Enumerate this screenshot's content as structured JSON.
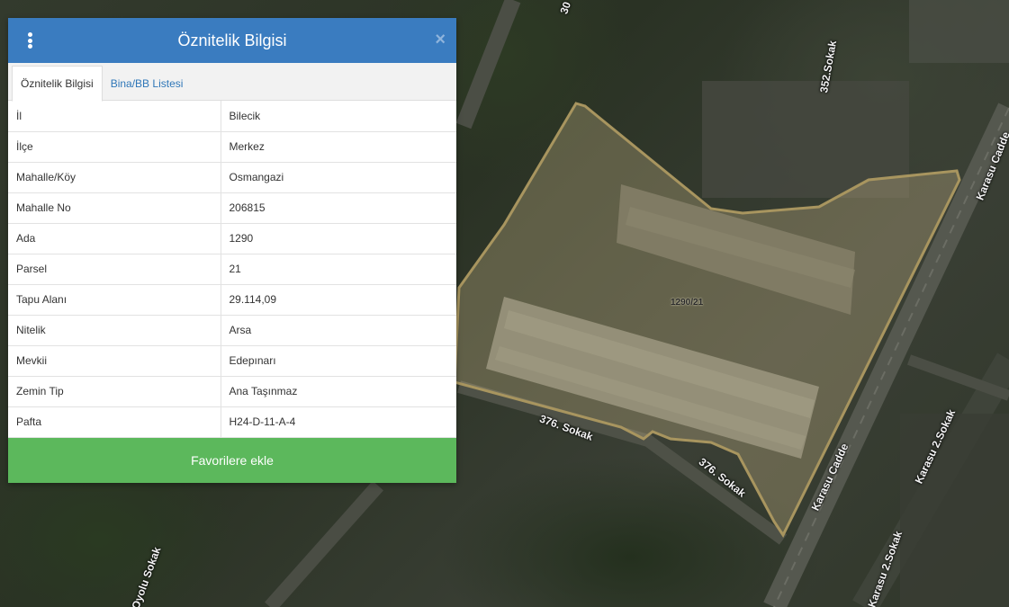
{
  "panel": {
    "title": "Öznitelik Bilgisi",
    "tabs": [
      {
        "label": "Öznitelik Bilgisi",
        "active": true
      },
      {
        "label": "Bina/BB Listesi",
        "active": false
      }
    ],
    "rows": [
      {
        "key": "İl",
        "value": "Bilecik"
      },
      {
        "key": "İlçe",
        "value": "Merkez"
      },
      {
        "key": "Mahalle/Köy",
        "value": "Osmangazi"
      },
      {
        "key": "Mahalle No",
        "value": "206815"
      },
      {
        "key": "Ada",
        "value": "1290"
      },
      {
        "key": "Parsel",
        "value": "21"
      },
      {
        "key": "Tapu Alanı",
        "value": "29.114,09"
      },
      {
        "key": "Nitelik",
        "value": "Arsa"
      },
      {
        "key": "Mevkii",
        "value": "Edepınarı"
      },
      {
        "key": "Zemin Tip",
        "value": "Ana Taşınmaz"
      },
      {
        "key": "Pafta",
        "value": "H24-D-11-A-4"
      }
    ],
    "favorite_button": "Favorilere ekle",
    "close_symbol": "×",
    "menu_icon": "vertical-dots-icon",
    "accent_color": "#3a7cc0",
    "button_color": "#5cb85c"
  },
  "map": {
    "parcel_label": "1290/21",
    "road_labels": [
      "352.Sokak",
      "Karasu Cadde",
      "376. Sokak",
      "376. Sokak",
      "Karasu Cadde",
      "Karasu 2.Sokak",
      "Oyolu Sokak",
      "Karasu 2.Sokak",
      "30"
    ]
  }
}
